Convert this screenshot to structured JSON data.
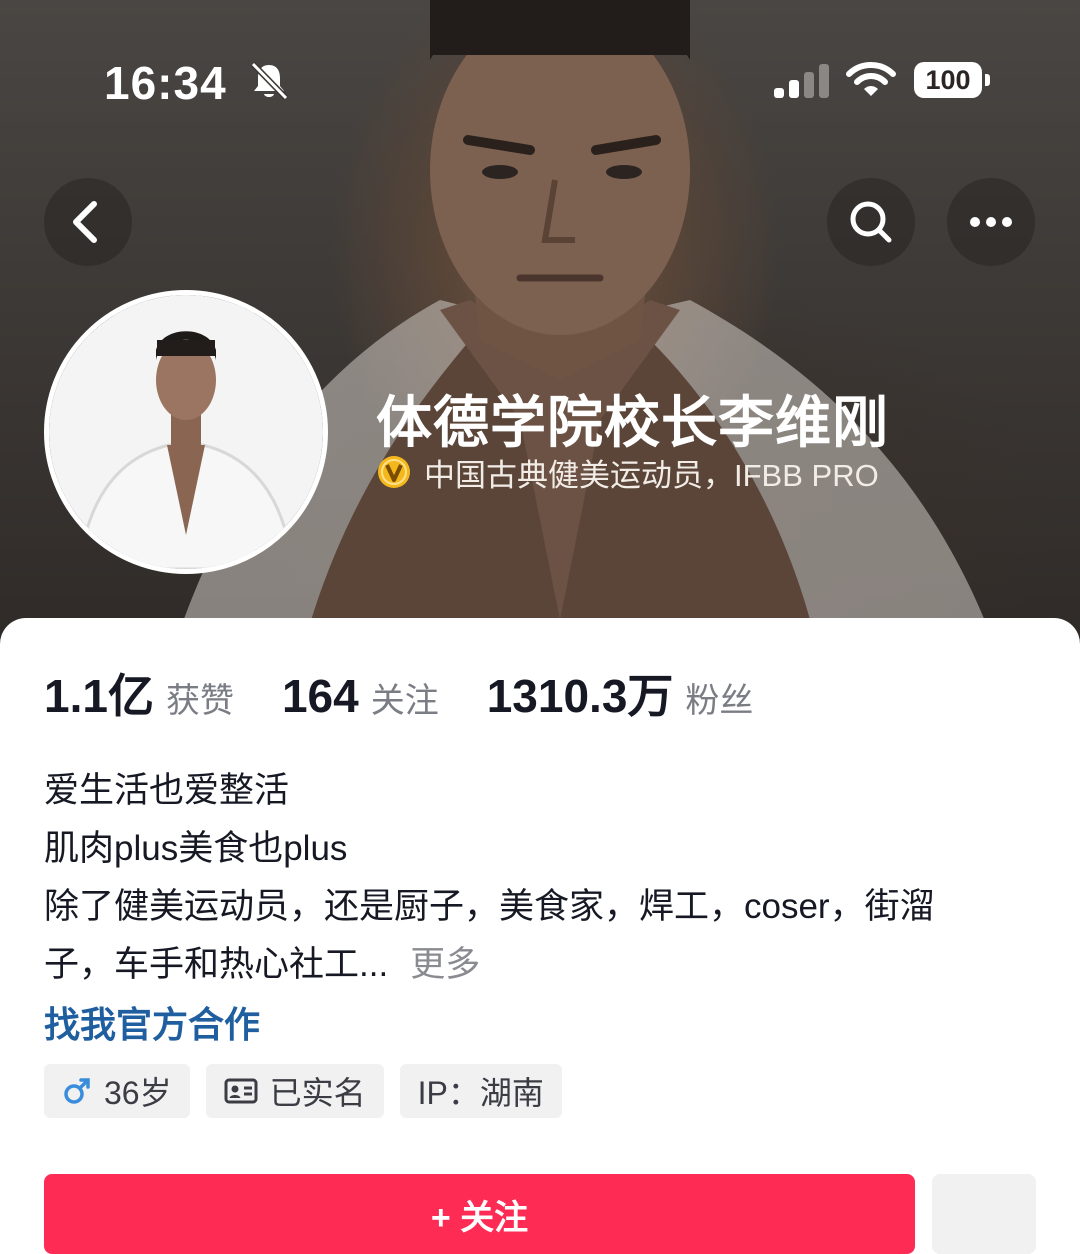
{
  "status_bar": {
    "time": "16:34",
    "battery": "100",
    "icons": [
      "bell-slash-icon",
      "signal-icon",
      "wifi-icon",
      "battery-icon"
    ]
  },
  "nav": {
    "icons": [
      "chevron-left-icon",
      "search-icon",
      "more-icon"
    ]
  },
  "profile": {
    "name": "体德学院校长李维刚",
    "verification_text": "中国古典健美运动员，IFBB PRO",
    "verified_badge_color": "#f5b81c"
  },
  "stats": [
    {
      "value": "1.1亿",
      "label": "获赞"
    },
    {
      "value": "164",
      "label": "关注"
    },
    {
      "value": "1310.3万",
      "label": "粉丝"
    }
  ],
  "bio": {
    "lines": [
      "爱生活也爱整活",
      "肌肉plus美食也plus",
      "除了健美运动员，还是厨子，美食家，焊工，coser，街溜",
      "子，车手和热心社工..."
    ],
    "more": "更多",
    "collab_link": "找我官方合作"
  },
  "tags": [
    {
      "icon": "male-icon",
      "text": "36岁"
    },
    {
      "icon": "id-card-icon",
      "text": "已实名"
    },
    {
      "icon": "",
      "text": "IP：湖南"
    }
  ],
  "actions": {
    "follow_label": "+ 关注",
    "follow_color": "#fe2c55"
  }
}
